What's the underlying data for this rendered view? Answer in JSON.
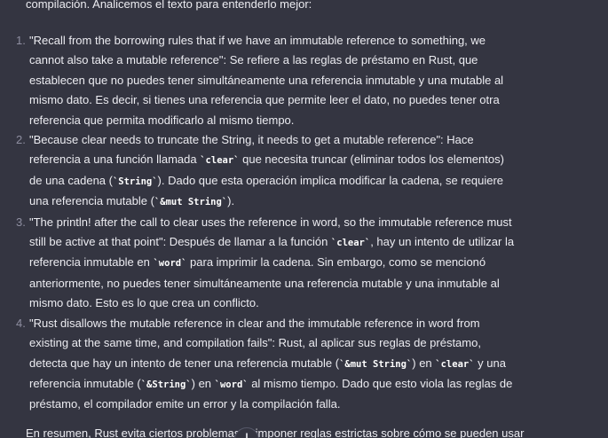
{
  "intro": "compilación. Analicemos el texto para entenderlo mejor:",
  "items": [
    {
      "num": "1.",
      "parts": [
        {
          "t": "text",
          "v": "\"Recall from the borrowing rules that if we have an immutable reference to something, we cannot also take a mutable reference\": Se refiere a las reglas de préstamo en Rust, que establecen que no puedes tener simultáneamente una referencia inmutable y una mutable al mismo dato. Es decir, si tienes una referencia que permite leer el dato, no puedes tener otra referencia que permita modificarlo al mismo tiempo."
        }
      ]
    },
    {
      "num": "2.",
      "parts": [
        {
          "t": "text",
          "v": "\"Because clear needs to truncate the String, it needs to get a mutable reference\": Hace referencia a una función llamada "
        },
        {
          "t": "code",
          "v": "`clear`"
        },
        {
          "t": "text",
          "v": " que necesita truncar (eliminar todos los elementos) de una cadena ("
        },
        {
          "t": "code",
          "v": "`String`"
        },
        {
          "t": "text",
          "v": "). Dado que esta operación implica modificar la cadena, se requiere una referencia mutable ("
        },
        {
          "t": "code",
          "v": "`&mut String`"
        },
        {
          "t": "text",
          "v": ")."
        }
      ]
    },
    {
      "num": "3.",
      "parts": [
        {
          "t": "text",
          "v": "\"The println! after the call to clear uses the reference in word, so the immutable reference must still be active at that point\": Después de llamar a la función "
        },
        {
          "t": "code",
          "v": "`clear`"
        },
        {
          "t": "text",
          "v": ", hay un intento de utilizar la referencia inmutable en "
        },
        {
          "t": "code",
          "v": "`word`"
        },
        {
          "t": "text",
          "v": " para imprimir la cadena. Sin embargo, como se mencionó anteriormente, no puedes tener simultáneamente una referencia mutable y una inmutable al mismo dato. Esto es lo que crea un conflicto."
        }
      ]
    },
    {
      "num": "4.",
      "parts": [
        {
          "t": "text",
          "v": "\"Rust disallows the mutable reference in clear and the immutable reference in word from existing at the same time, and compilation fails\": Rust, al aplicar sus reglas de préstamo, detecta que hay un intento de tener una referencia mutable ("
        },
        {
          "t": "code",
          "v": "`&mut String`"
        },
        {
          "t": "text",
          "v": ") en "
        },
        {
          "t": "code",
          "v": "`clear`"
        },
        {
          "t": "text",
          "v": " y una referencia inmutable ("
        },
        {
          "t": "code",
          "v": "`&String`"
        },
        {
          "t": "text",
          "v": ") en "
        },
        {
          "t": "code",
          "v": "`word`"
        },
        {
          "t": "text",
          "v": " al mismo tiempo. Dado que esto viola las reglas de préstamo, el compilador emite un error y la compilación falla."
        }
      ]
    }
  ],
  "outro": "En resumen, Rust evita ciertos problemas al imponer reglas estrictas sobre cómo se pueden usar",
  "scroll_button": {
    "icon": "arrow-down-icon"
  }
}
